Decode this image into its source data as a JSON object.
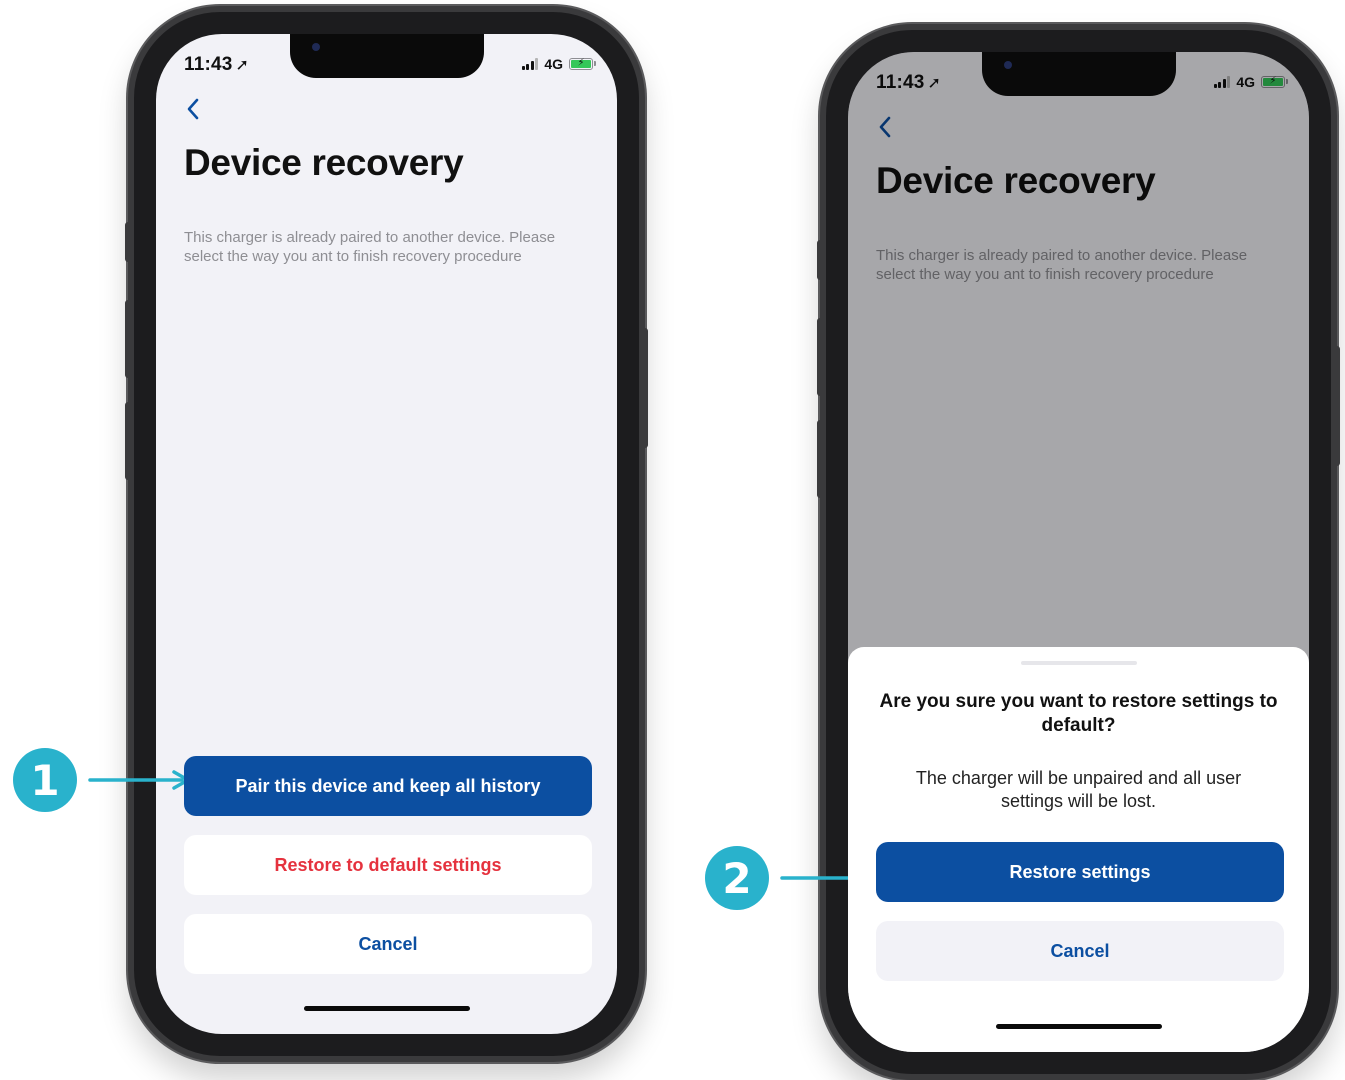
{
  "colors": {
    "primary": "#0c4fa1",
    "destructive": "#e5323e",
    "accent_teal": "#29b2cc",
    "screen_bg": "#f2f2f7"
  },
  "screen1": {
    "status": {
      "time": "11:43",
      "network": "4G"
    },
    "back_icon": "chevron-left-icon",
    "title": "Device recovery",
    "description": "This charger is already paired to another device. Please select the way you ant to finish recovery procedure",
    "buttons": {
      "pair": "Pair this device and keep all history",
      "restore": "Restore to default settings",
      "cancel": "Cancel"
    }
  },
  "screen2": {
    "status": {
      "time": "11:43",
      "network": "4G"
    },
    "back_icon": "chevron-left-icon",
    "title": "Device recovery",
    "description": "This charger is already paired to another device. Please select the way you ant to finish recovery procedure",
    "sheet": {
      "title": "Are you sure you want to restore settings to default?",
      "message": "The charger will be unpaired and all user settings will be lost.",
      "confirm": "Restore settings",
      "cancel": "Cancel"
    }
  },
  "annotations": {
    "step1": "1",
    "step2": "2"
  }
}
